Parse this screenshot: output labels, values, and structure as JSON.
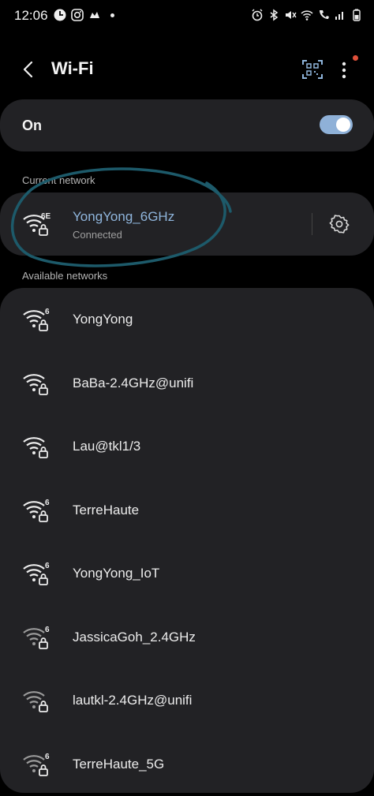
{
  "status_bar": {
    "time": "12:06",
    "left_icons": [
      "clock-icon",
      "instagram-icon",
      "cloud-icon"
    ],
    "right_icons": [
      "alarm-icon",
      "bluetooth-icon",
      "mute-icon",
      "wifi-icon",
      "call-wifi-icon",
      "signal-icon",
      "battery-icon"
    ]
  },
  "app_bar": {
    "title": "Wi-Fi"
  },
  "toggle": {
    "label": "On",
    "enabled": true
  },
  "current_network": {
    "header": "Current network",
    "name": "YongYong_6GHz",
    "status": "Connected",
    "badge": "6E"
  },
  "available_networks": {
    "header": "Available networks",
    "items": [
      {
        "name": "YongYong",
        "badge": "6",
        "locked": true,
        "dim": false
      },
      {
        "name": "BaBa-2.4GHz@unifi",
        "badge": "",
        "locked": true,
        "dim": false
      },
      {
        "name": "Lau@tkl1/3",
        "badge": "",
        "locked": true,
        "dim": false
      },
      {
        "name": "TerreHaute",
        "badge": "6",
        "locked": true,
        "dim": false
      },
      {
        "name": "YongYong_IoT",
        "badge": "6",
        "locked": true,
        "dim": false
      },
      {
        "name": "JassicaGoh_2.4GHz",
        "badge": "6",
        "locked": true,
        "dim": true
      },
      {
        "name": "lautkl-2.4GHz@unifi",
        "badge": "",
        "locked": true,
        "dim": true
      },
      {
        "name": "TerreHaute_5G",
        "badge": "6",
        "locked": true,
        "dim": true
      }
    ]
  },
  "colors": {
    "background": "#000000",
    "card": "#222225",
    "accent": "#8fb5dc",
    "annotation": "#1d5a6a"
  }
}
